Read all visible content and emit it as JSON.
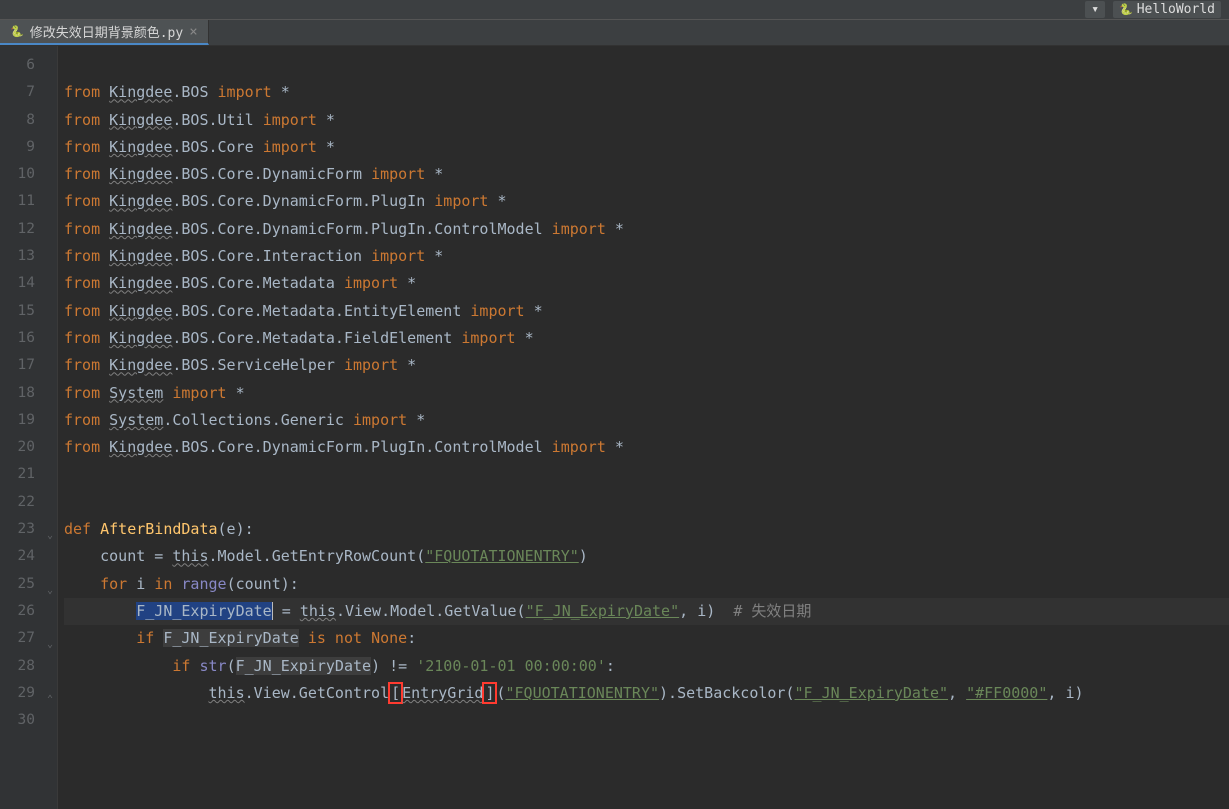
{
  "topbar": {
    "config_label": "HelloWorld"
  },
  "tab": {
    "filename": "修改失效日期背景颜色.py"
  },
  "gutter": {
    "start": 6,
    "count": 25
  },
  "code": {
    "lines": [
      {
        "n": 6,
        "tokens": []
      },
      {
        "n": 7,
        "tokens": [
          {
            "t": "from ",
            "c": "kw"
          },
          {
            "t": "Kingdee",
            "c": "module"
          },
          {
            "t": ".BOS ",
            "c": "ident"
          },
          {
            "t": "import",
            "c": "kw"
          },
          {
            "t": " *",
            "c": "op"
          }
        ]
      },
      {
        "n": 8,
        "tokens": [
          {
            "t": "from ",
            "c": "kw"
          },
          {
            "t": "Kingdee",
            "c": "module"
          },
          {
            "t": ".BOS.Util ",
            "c": "ident"
          },
          {
            "t": "import",
            "c": "kw"
          },
          {
            "t": " *",
            "c": "op"
          }
        ]
      },
      {
        "n": 9,
        "tokens": [
          {
            "t": "from ",
            "c": "kw"
          },
          {
            "t": "Kingdee",
            "c": "module"
          },
          {
            "t": ".BOS.Core ",
            "c": "ident"
          },
          {
            "t": "import",
            "c": "kw"
          },
          {
            "t": " *",
            "c": "op"
          }
        ]
      },
      {
        "n": 10,
        "tokens": [
          {
            "t": "from ",
            "c": "kw"
          },
          {
            "t": "Kingdee",
            "c": "module"
          },
          {
            "t": ".BOS.Core.DynamicForm ",
            "c": "ident"
          },
          {
            "t": "import",
            "c": "kw"
          },
          {
            "t": " *",
            "c": "op"
          }
        ]
      },
      {
        "n": 11,
        "tokens": [
          {
            "t": "from ",
            "c": "kw"
          },
          {
            "t": "Kingdee",
            "c": "module"
          },
          {
            "t": ".BOS.Core.DynamicForm.PlugIn ",
            "c": "ident"
          },
          {
            "t": "import",
            "c": "kw"
          },
          {
            "t": " *",
            "c": "op"
          }
        ]
      },
      {
        "n": 12,
        "tokens": [
          {
            "t": "from ",
            "c": "kw"
          },
          {
            "t": "Kingdee",
            "c": "module"
          },
          {
            "t": ".BOS.Core.DynamicForm.PlugIn.ControlModel ",
            "c": "ident"
          },
          {
            "t": "import",
            "c": "kw"
          },
          {
            "t": " *",
            "c": "op"
          }
        ]
      },
      {
        "n": 13,
        "tokens": [
          {
            "t": "from ",
            "c": "kw"
          },
          {
            "t": "Kingdee",
            "c": "module"
          },
          {
            "t": ".BOS.Core.Interaction ",
            "c": "ident"
          },
          {
            "t": "import",
            "c": "kw"
          },
          {
            "t": " *",
            "c": "op"
          }
        ]
      },
      {
        "n": 14,
        "tokens": [
          {
            "t": "from ",
            "c": "kw"
          },
          {
            "t": "Kingdee",
            "c": "module"
          },
          {
            "t": ".BOS.Core.Metadata ",
            "c": "ident"
          },
          {
            "t": "import",
            "c": "kw"
          },
          {
            "t": " *",
            "c": "op"
          }
        ]
      },
      {
        "n": 15,
        "tokens": [
          {
            "t": "from ",
            "c": "kw"
          },
          {
            "t": "Kingdee",
            "c": "module"
          },
          {
            "t": ".BOS.Core.Metadata.EntityElement ",
            "c": "ident"
          },
          {
            "t": "import",
            "c": "kw"
          },
          {
            "t": " *",
            "c": "op"
          }
        ]
      },
      {
        "n": 16,
        "tokens": [
          {
            "t": "from ",
            "c": "kw"
          },
          {
            "t": "Kingdee",
            "c": "module"
          },
          {
            "t": ".BOS.Core.Metadata.FieldElement ",
            "c": "ident"
          },
          {
            "t": "import",
            "c": "kw"
          },
          {
            "t": " *",
            "c": "op"
          }
        ]
      },
      {
        "n": 17,
        "tokens": [
          {
            "t": "from ",
            "c": "kw"
          },
          {
            "t": "Kingdee",
            "c": "module"
          },
          {
            "t": ".BOS.ServiceHelper ",
            "c": "ident"
          },
          {
            "t": "import",
            "c": "kw"
          },
          {
            "t": " *",
            "c": "op"
          }
        ]
      },
      {
        "n": 18,
        "tokens": [
          {
            "t": "from ",
            "c": "kw"
          },
          {
            "t": "System",
            "c": "module"
          },
          {
            "t": " ",
            "c": "ident"
          },
          {
            "t": "import",
            "c": "kw"
          },
          {
            "t": " *",
            "c": "op"
          }
        ]
      },
      {
        "n": 19,
        "tokens": [
          {
            "t": "from ",
            "c": "kw"
          },
          {
            "t": "System",
            "c": "module"
          },
          {
            "t": ".Collections.Generic ",
            "c": "ident"
          },
          {
            "t": "import",
            "c": "kw"
          },
          {
            "t": " *",
            "c": "op"
          }
        ]
      },
      {
        "n": 20,
        "tokens": [
          {
            "t": "from ",
            "c": "kw"
          },
          {
            "t": "Kingdee",
            "c": "module"
          },
          {
            "t": ".BOS.Core.DynamicForm.PlugIn.ControlModel ",
            "c": "ident"
          },
          {
            "t": "import",
            "c": "kw"
          },
          {
            "t": " *",
            "c": "op"
          }
        ]
      },
      {
        "n": 21,
        "tokens": []
      },
      {
        "n": 22,
        "tokens": []
      },
      {
        "n": 23,
        "tokens": [
          {
            "t": "def ",
            "c": "kw"
          },
          {
            "t": "AfterBindData",
            "c": "func"
          },
          {
            "t": "(e):",
            "c": "op"
          }
        ],
        "fold": "down"
      },
      {
        "n": 24,
        "tokens": [
          {
            "t": "    count = ",
            "c": "ident"
          },
          {
            "t": "this",
            "c": "module"
          },
          {
            "t": ".Model.GetEntryRowCount(",
            "c": "ident"
          },
          {
            "t": "\"FQUOTATIONENTRY\"",
            "c": "str-link"
          },
          {
            "t": ")",
            "c": "ident"
          }
        ]
      },
      {
        "n": 25,
        "tokens": [
          {
            "t": "    ",
            "c": ""
          },
          {
            "t": "for ",
            "c": "kw"
          },
          {
            "t": "i ",
            "c": "ident"
          },
          {
            "t": "in ",
            "c": "kw"
          },
          {
            "t": "range",
            "c": "builtin"
          },
          {
            "t": "(count):",
            "c": "ident"
          }
        ],
        "fold": "down"
      },
      {
        "n": 26,
        "current": true,
        "tokens": [
          {
            "t": "        ",
            "c": ""
          },
          {
            "t": "F_JN_ExpiryDate",
            "c": "ident",
            "sel": true
          },
          {
            "t": " = ",
            "c": "op"
          },
          {
            "t": "this",
            "c": "module"
          },
          {
            "t": ".View.Model.GetValue(",
            "c": "ident"
          },
          {
            "t": "\"F_JN_ExpiryDate\"",
            "c": "str-link"
          },
          {
            "t": ", ",
            "c": "op"
          },
          {
            "t": "i)  ",
            "c": "ident"
          },
          {
            "t": "# 失效日期",
            "c": "comment"
          }
        ]
      },
      {
        "n": 27,
        "tokens": [
          {
            "t": "        ",
            "c": ""
          },
          {
            "t": "if ",
            "c": "kw"
          },
          {
            "t": "F_JN_ExpiryDate",
            "c": "ident",
            "hl": true
          },
          {
            "t": " ",
            "c": ""
          },
          {
            "t": "is not ",
            "c": "kw"
          },
          {
            "t": "None",
            "c": "kw"
          },
          {
            "t": ":",
            "c": "op"
          }
        ],
        "fold": "down"
      },
      {
        "n": 28,
        "tokens": [
          {
            "t": "            ",
            "c": ""
          },
          {
            "t": "if ",
            "c": "kw"
          },
          {
            "t": "str",
            "c": "builtin"
          },
          {
            "t": "(",
            "c": "op"
          },
          {
            "t": "F_JN_ExpiryDate",
            "c": "ident",
            "hl": true
          },
          {
            "t": ") != ",
            "c": "op"
          },
          {
            "t": "'2100-01-01 00:00:00'",
            "c": "str"
          },
          {
            "t": ":",
            "c": "op"
          }
        ]
      },
      {
        "n": 29,
        "tokens": [
          {
            "t": "                ",
            "c": ""
          },
          {
            "t": "this",
            "c": "module"
          },
          {
            "t": ".View.GetControl",
            "c": "ident"
          },
          {
            "t": "[",
            "c": "op",
            "red": true
          },
          {
            "t": "EntryGrid",
            "c": "module"
          },
          {
            "t": "]",
            "c": "op",
            "red": true
          },
          {
            "t": "(",
            "c": "op"
          },
          {
            "t": "\"FQUOTATIONENTRY\"",
            "c": "str-link"
          },
          {
            "t": ").SetBackcolor(",
            "c": "ident"
          },
          {
            "t": "\"F_JN_ExpiryDate\"",
            "c": "str-link"
          },
          {
            "t": ", ",
            "c": "op"
          },
          {
            "t": "\"#FF0000\"",
            "c": "str-link"
          },
          {
            "t": ", ",
            "c": "op"
          },
          {
            "t": "i)",
            "c": "ident"
          }
        ],
        "fold": "up"
      },
      {
        "n": 30,
        "tokens": []
      }
    ]
  }
}
